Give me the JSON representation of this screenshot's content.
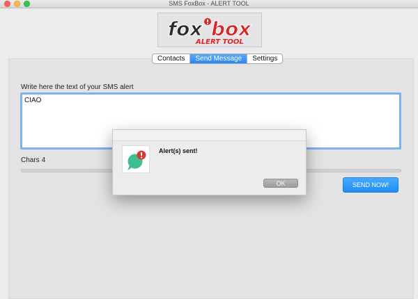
{
  "window": {
    "title": "SMS FoxBox - ALERT TOOL",
    "controls": [
      "close-icon",
      "minimize-icon",
      "zoom-icon"
    ]
  },
  "logo": {
    "word_fox": "fox",
    "word_box": "box",
    "subtitle": "ALERT TOOL",
    "colors": {
      "fox": "#2a2a2a",
      "box": "#d8252a",
      "badge": "#d8252a"
    }
  },
  "tabs": [
    {
      "label": "Contacts",
      "active": false
    },
    {
      "label": "Send Message",
      "active": true
    },
    {
      "label": "Settings",
      "active": false
    }
  ],
  "message": {
    "label": "Write here the text of your SMS alert",
    "value": "CIAO",
    "chars_label": "Chars",
    "chars_count": "4",
    "progress_fraction": 0.0
  },
  "send_button": {
    "label": "SEND NOW!"
  },
  "dialog": {
    "text": "Alert(s) sent!",
    "ok_label": "OK",
    "icon": "chat-bubble-alert-icon",
    "colors": {
      "bubble": "#3fbf8f",
      "badge": "#d83a32"
    }
  },
  "colors": {
    "accent": "#2b86f1",
    "input_focus": "#7fb1ee"
  }
}
